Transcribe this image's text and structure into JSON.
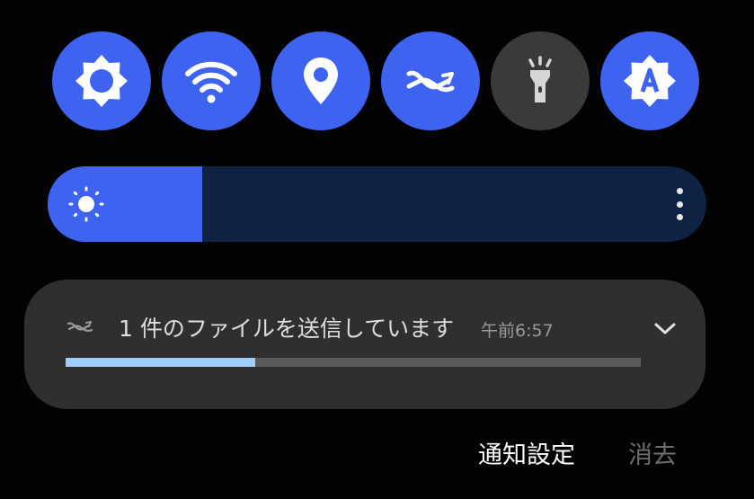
{
  "quick_toggles": [
    {
      "icon": "auto-brightness-sun-icon",
      "state": "on"
    },
    {
      "icon": "wifi-icon",
      "state": "on"
    },
    {
      "icon": "location-pin-icon",
      "state": "on"
    },
    {
      "icon": "quick-share-icon",
      "state": "on"
    },
    {
      "icon": "flashlight-icon",
      "state": "off"
    },
    {
      "icon": "auto-brightness-a-icon",
      "state": "on"
    }
  ],
  "brightness": {
    "level_fraction": 0.235,
    "icon": "sun-icon",
    "more_icon": "more-vertical-icon"
  },
  "notification": {
    "app_icon": "quick-share-icon",
    "title": "1 件のファイルを送信しています",
    "time": "午前6:57",
    "expand_icon": "chevron-down-icon",
    "progress_fraction": 0.33
  },
  "actions": {
    "settings_label": "通知設定",
    "clear_label": "消去"
  },
  "colors": {
    "accent": "#3e63f0",
    "toggle_off": "#3a3a3a",
    "slider_track": "#0f2244",
    "card_bg": "#2f2f2f",
    "progress": "#9ed0ff"
  }
}
